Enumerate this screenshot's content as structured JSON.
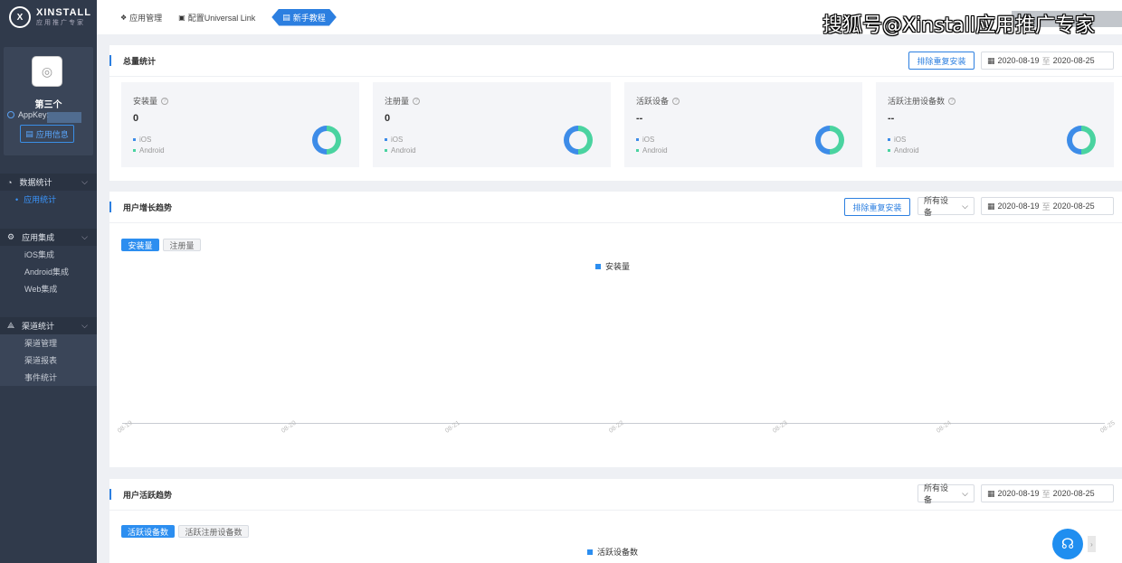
{
  "brand": {
    "name": "XINSTALL",
    "sub": "应用推广专家",
    "mark": "X"
  },
  "app": {
    "name": "第三个",
    "appkey_label": "AppKey:",
    "info_button": "应用信息"
  },
  "sidebar": {
    "groups": [
      {
        "title": "数据统计",
        "items": [
          "应用统计"
        ]
      },
      {
        "title": "应用集成",
        "items": [
          "iOS集成",
          "Android集成",
          "Web集成"
        ]
      },
      {
        "title": "渠道统计",
        "items": [
          "渠道管理",
          "渠道报表",
          "事件统计"
        ]
      }
    ]
  },
  "topbar": {
    "links": [
      "应用管理",
      "配置Universal Link"
    ],
    "active": "新手教程"
  },
  "watermark": "搜狐号@Xinstall应用推广专家",
  "total": {
    "title": "总量统计",
    "exclude_button": "排除重复安装",
    "date_start": "2020-08-19",
    "date_sep": "至",
    "date_end": "2020-08-25",
    "cards": [
      {
        "label": "安装量",
        "value": "0",
        "ios": "iOS",
        "android": "Android"
      },
      {
        "label": "注册量",
        "value": "0",
        "ios": "iOS",
        "android": "Android"
      },
      {
        "label": "活跃设备",
        "value": "--",
        "ios": "iOS",
        "android": "Android"
      },
      {
        "label": "活跃注册设备数",
        "value": "--",
        "ios": "iOS",
        "android": "Android"
      }
    ]
  },
  "growth": {
    "title": "用户增长趋势",
    "exclude_button": "排除重复安装",
    "device_select": "所有设备",
    "date_start": "2020-08-19",
    "date_sep": "至",
    "date_end": "2020-08-25",
    "tabs": [
      "安装量",
      "注册量"
    ],
    "legend": "安装量",
    "x_ticks": [
      "08-19",
      "08-20",
      "08-21",
      "08-22",
      "08-23",
      "08-24",
      "08-25"
    ]
  },
  "active": {
    "title": "用户活跃趋势",
    "device_select": "所有设备",
    "date_start": "2020-08-19",
    "date_sep": "至",
    "date_end": "2020-08-25",
    "tabs": [
      "活跃设备数",
      "活跃注册设备数"
    ],
    "legend": "活跃设备数"
  },
  "colors": {
    "primary": "#2c7fe0",
    "ios": "#3d8ce8",
    "android": "#4ad3a0",
    "sidebar": "#303a4b"
  }
}
